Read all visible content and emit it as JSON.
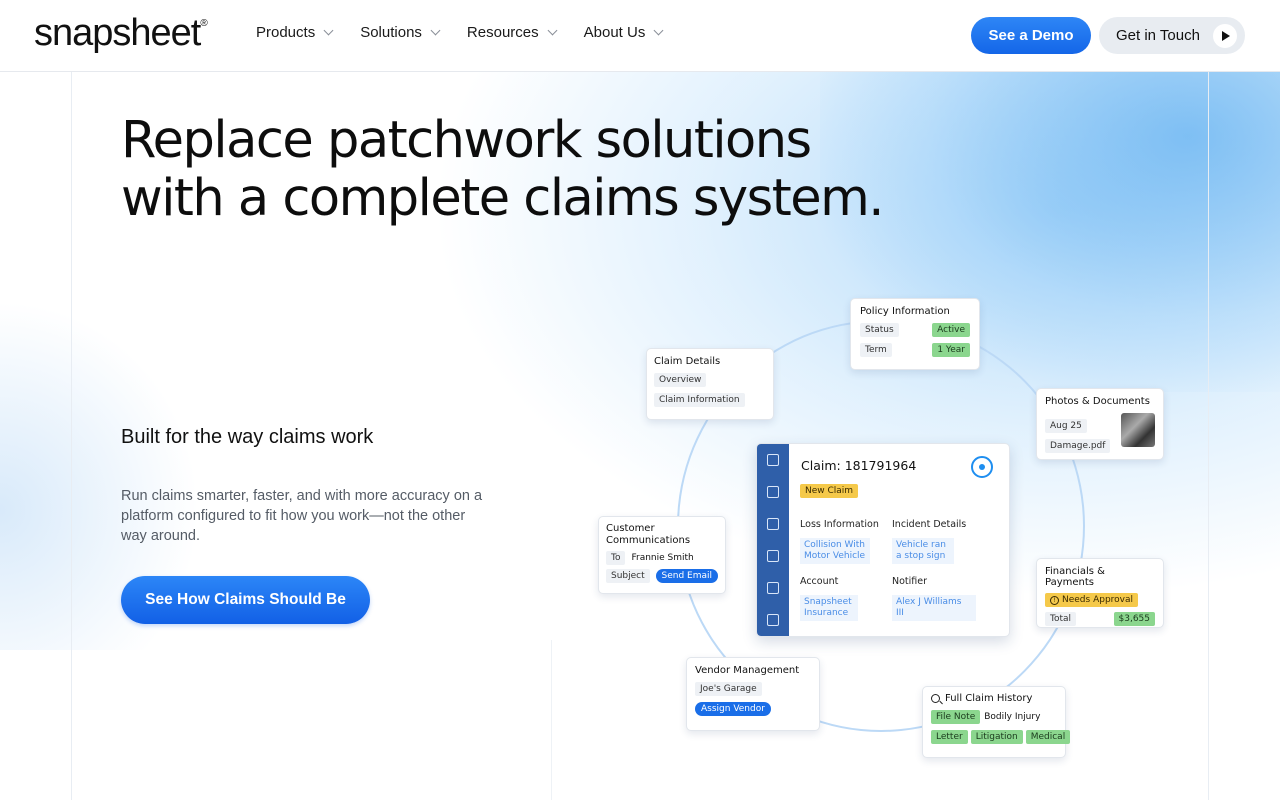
{
  "header": {
    "logo": "snapsheet",
    "nav": [
      {
        "label": "Products"
      },
      {
        "label": "Solutions"
      },
      {
        "label": "Resources"
      },
      {
        "label": "About Us"
      }
    ],
    "demo_button": "See a Demo",
    "touch_button": "Get in Touch"
  },
  "hero": {
    "headline_line1": "Replace patchwork solutions",
    "headline_line2": "with a complete claims system.",
    "subhead": "Built for the way claims work",
    "description": "Run claims smarter, faster, and with more accuracy on a platform configured to fit how you work—not the other way around.",
    "cta": "See How Claims Should Be"
  },
  "illustration": {
    "policy": {
      "title": "Policy Information",
      "status_label": "Status",
      "status_value": "Active",
      "term_label": "Term",
      "term_value": "1 Year"
    },
    "claim_details": {
      "title": "Claim Details",
      "item1": "Overview",
      "item2": "Claim Information"
    },
    "photos": {
      "title": "Photos & Documents",
      "date": "Aug 25",
      "file": "Damage.pdf"
    },
    "customer": {
      "title": "Customer Communications",
      "to_label": "To",
      "to_value": "Frannie Smith",
      "subject_label": "Subject",
      "send": "Send Email"
    },
    "financials": {
      "title": "Financials & Payments",
      "needs": "Needs Approval",
      "total_label": "Total",
      "total_value": "$3,655"
    },
    "vendor": {
      "title": "Vendor Management",
      "garage": "Joe's Garage",
      "assign": "Assign Vendor"
    },
    "history": {
      "title": "Full Claim History",
      "tags": [
        "File Note",
        "Bodily Injury",
        "Letter",
        "Litigation",
        "Medical"
      ]
    },
    "main": {
      "title": "Claim: 181791964",
      "badge": "New Claim",
      "loss_label": "Loss Information",
      "loss_value": "Collision With Motor Vehicle",
      "incident_label": "Incident Details",
      "incident_value": "Vehicle ran a stop sign",
      "account_label": "Account",
      "account_value": "Snapsheet Insurance",
      "notifier_label": "Notifier",
      "notifier_value": "Alex J Williams III"
    }
  },
  "colors": {
    "accent": "#1a6ee8",
    "green_tag": "#8bd68e",
    "yellow_tag": "#f5c94a",
    "sidebar": "#2f5fa9"
  }
}
